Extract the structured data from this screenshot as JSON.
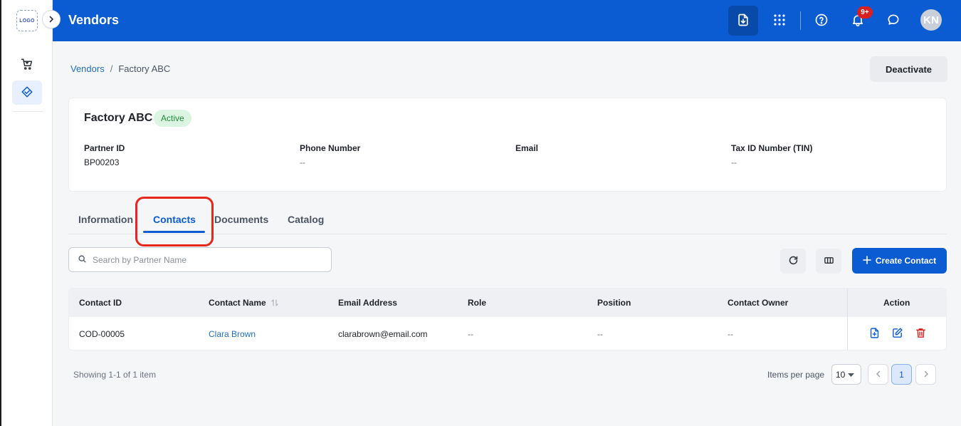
{
  "app": {
    "logo_text": "LOGO",
    "title": "Vendors",
    "notification_count": "9+",
    "user_initials": "KN"
  },
  "sidebar": {
    "items": [
      {
        "icon": "shopping-cart-icon",
        "active": false
      },
      {
        "icon": "vendor-handshake-icon",
        "active": true
      }
    ]
  },
  "breadcrumb": {
    "parent": "Vendors",
    "separator": "/",
    "current": "Factory ABC"
  },
  "actions": {
    "deactivate_label": "Deactivate"
  },
  "partner": {
    "name": "Factory ABC",
    "status": "Active",
    "fields": [
      {
        "label": "Partner ID",
        "value": "BP00203"
      },
      {
        "label": "Phone Number",
        "value": "--"
      },
      {
        "label": "Email",
        "value": ""
      },
      {
        "label": "Tax ID Number (TIN)",
        "value": "--"
      }
    ]
  },
  "tabs": [
    {
      "label": "Information",
      "active": false
    },
    {
      "label": "Contacts",
      "active": true
    },
    {
      "label": "Documents",
      "active": false
    },
    {
      "label": "Catalog",
      "active": false
    }
  ],
  "toolbar": {
    "search_placeholder": "Search by Partner Name",
    "create_label": "Create Contact"
  },
  "table": {
    "columns": [
      "Contact ID",
      "Contact Name",
      "Email Address",
      "Role",
      "Position",
      "Contact Owner",
      "Action"
    ],
    "rows": [
      {
        "contact_id": "COD-00005",
        "contact_name": "Clara Brown",
        "email": "clarabrown@email.com",
        "role": "--",
        "position": "--",
        "owner": "--"
      }
    ]
  },
  "pagination": {
    "showing": "Showing 1-1 of 1 item",
    "items_per_page_label": "Items per page",
    "items_per_page": "10",
    "current_page": "1"
  },
  "colors": {
    "primary": "#0b5bd3",
    "status_active_bg": "#dcf5e3",
    "status_active_text": "#1f8a3b",
    "danger": "#d92020",
    "highlight": "#e8261c"
  }
}
